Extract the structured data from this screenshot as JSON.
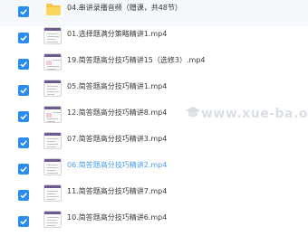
{
  "files": [
    {
      "type": "folder",
      "name": "04.串讲录播音频（赠课，共48节）",
      "checked": true,
      "active": false
    },
    {
      "type": "video",
      "name": "01.选择题满分策略精讲1.mp4",
      "checked": true,
      "active": false
    },
    {
      "type": "video",
      "name": "19.简答题高分技巧精讲15（选修3）.mp4",
      "checked": true,
      "active": false
    },
    {
      "type": "video",
      "name": "05.简答题高分技巧精讲1.mp4",
      "checked": true,
      "active": false
    },
    {
      "type": "video",
      "name": "12.简答题高分技巧精讲8.mp4",
      "checked": true,
      "active": false
    },
    {
      "type": "video",
      "name": "07.简答题高分技巧精讲3.mp4",
      "checked": true,
      "active": false
    },
    {
      "type": "video",
      "name": "06.简答题高分技巧精讲2.mp4",
      "checked": true,
      "active": true
    },
    {
      "type": "video",
      "name": "11.简答题高分技巧精讲7.mp4",
      "checked": true,
      "active": false
    },
    {
      "type": "video",
      "name": "10.简答题高分技巧精讲6.mp4",
      "checked": true,
      "active": false
    }
  ],
  "watermark": "www.xue-ba.org",
  "colors": {
    "checkbox": "#2b8cf0",
    "active_text": "#4a9ef5",
    "folder": "#f7c843"
  }
}
